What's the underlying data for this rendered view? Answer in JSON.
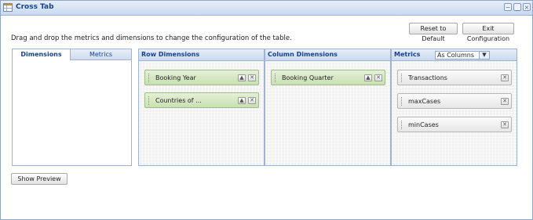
{
  "window": {
    "title": "Cross Tab"
  },
  "toolbar": {
    "reset_label": "Reset to Default",
    "exit_label": "Exit Configuration"
  },
  "instructions": "Drag and drop the metrics and dimensions to change the configuration of the table.",
  "left_tabs": [
    {
      "label": "Dimensions",
      "active": true
    },
    {
      "label": "Metrics",
      "active": false
    }
  ],
  "row_dimensions": {
    "title": "Row Dimensions",
    "items": [
      {
        "label": "Booking Year"
      },
      {
        "label": "Countries of ..."
      }
    ]
  },
  "column_dimensions": {
    "title": "Column Dimensions",
    "items": [
      {
        "label": "Booking Quarter"
      }
    ]
  },
  "metrics": {
    "title": "Metrics",
    "display_mode": "As Columns",
    "items": [
      {
        "label": "Transactions"
      },
      {
        "label": "maxCases"
      },
      {
        "label": "minCases"
      }
    ]
  },
  "preview_label": "Show Preview",
  "colors": {
    "accent": "#15428b",
    "dimension_chip": "#c9e0b2",
    "panel_border": "#9db3d3"
  }
}
